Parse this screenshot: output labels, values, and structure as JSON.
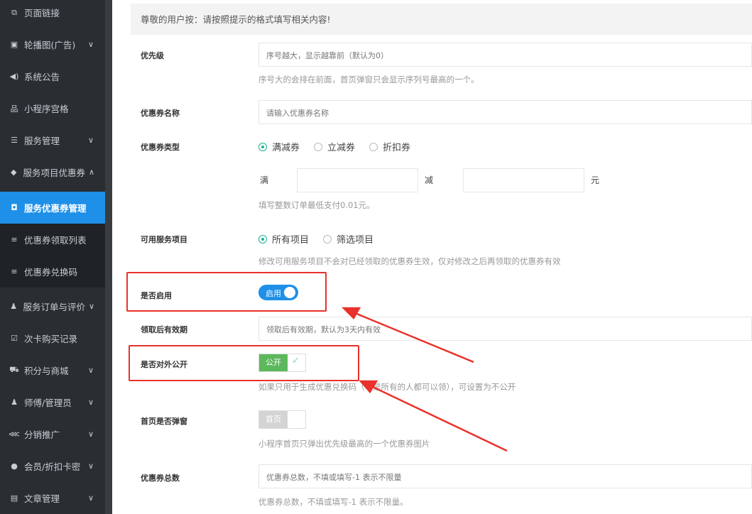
{
  "sidebar": {
    "items": [
      {
        "label": "页面链接",
        "icon": "link-icon",
        "glyph": "⧉"
      },
      {
        "label": "轮播图(广告)",
        "icon": "image-icon",
        "glyph": "▣",
        "chevron": "∨"
      },
      {
        "label": "系统公告",
        "icon": "speaker-icon",
        "glyph": "◀)"
      },
      {
        "label": "小程序宫格",
        "icon": "sitemap-icon",
        "glyph": "品"
      },
      {
        "label": "服务管理",
        "icon": "list-icon",
        "glyph": "☰",
        "chevron": "∨"
      },
      {
        "label": "服务项目优惠券",
        "icon": "tag-icon",
        "glyph": "◆",
        "chevron": "∧"
      },
      {
        "label": "服务优惠券管理",
        "icon": "gift-icon",
        "glyph": "◘",
        "active": true
      },
      {
        "label": "优惠券领取列表",
        "icon": "sliders-icon",
        "glyph": "≡",
        "sub": true
      },
      {
        "label": "优惠券兑换码",
        "icon": "sliders-icon",
        "glyph": "≡",
        "sub": true
      },
      {
        "label": "服务订单与评价",
        "icon": "user-icon",
        "glyph": "♟",
        "chevron": "∨"
      },
      {
        "label": "次卡购买记录",
        "icon": "checkbox-icon",
        "glyph": "☑"
      },
      {
        "label": "积分与商城",
        "icon": "cart-icon",
        "glyph": "⛟",
        "chevron": "∨"
      },
      {
        "label": "师傅/管理员",
        "icon": "user-icon",
        "glyph": "♟",
        "chevron": "∨"
      },
      {
        "label": "分销推广",
        "icon": "share-icon",
        "glyph": "⋘",
        "chevron": "∨"
      },
      {
        "label": "会员/折扣卡密",
        "icon": "user-circle-icon",
        "glyph": "●",
        "chevron": "∨"
      },
      {
        "label": "文章管理",
        "icon": "file-icon",
        "glyph": "▤",
        "chevron": "∨"
      }
    ]
  },
  "notice": "尊敬的用户按：请按照提示的格式填写相关内容!",
  "form": {
    "priority": {
      "label": "优先级",
      "placeholder": "序号越大，显示越靠前（默认为0）",
      "hint": "序号大的会排在前面，首页弹窗只会显示序列号最高的一个。"
    },
    "coupon_name": {
      "label": "优惠券名称",
      "placeholder": "请输入优惠券名称"
    },
    "coupon_type": {
      "label": "优惠券类型",
      "options": [
        "满减券",
        "立减券",
        "折扣券"
      ],
      "selected": "满减券"
    },
    "full_label": "满",
    "minus_label": "减",
    "yuan_label": "元",
    "amount_hint": "填写整数订单最低支付0.01元。",
    "service_items": {
      "label": "可用服务项目",
      "options": [
        "所有项目",
        "筛选项目"
      ],
      "selected": "所有项目",
      "hint": "修改可用服务项目不会对已经领取的优惠券生效，仅对修改之后再领取的优惠券有效"
    },
    "enabled": {
      "label": "是否启用",
      "toggle_text": "启用",
      "value": true
    },
    "validity": {
      "label": "领取后有效期",
      "placeholder": "领取后有效期，默认为3天内有效"
    },
    "public": {
      "label": "是否对外公开",
      "button_text": "公开",
      "hint": "如果只用于生成优惠兑换码（不是所有的人都可以领），可设置为不公开"
    },
    "home_popup": {
      "label": "首页是否弹窗",
      "button_text": "首页",
      "hint": "小程序首页只弹出优先级最高的一个优惠券图片"
    },
    "total": {
      "label": "优惠券总数",
      "placeholder": "优惠券总数，不填或填写-1 表示不限量",
      "hint": "优惠券总数，不填或填写-1 表示不限量。"
    }
  },
  "colors": {
    "accent": "#1e90e8",
    "success": "#5cb85c",
    "annotation": "#e8322a",
    "radio": "#1ab394"
  }
}
